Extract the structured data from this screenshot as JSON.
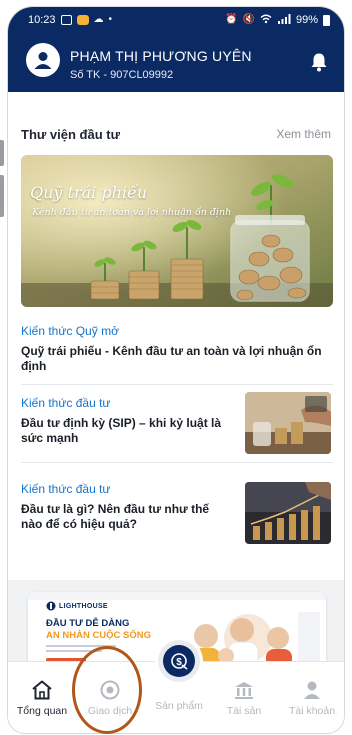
{
  "status_bar": {
    "time": "10:23",
    "battery": "99%"
  },
  "account": {
    "name": "PHẠM THỊ PHƯƠNG UYÊN",
    "number": "Số TK - 907CL09992"
  },
  "library": {
    "title": "Thư viện đầu tư",
    "see_more": "Xem thêm"
  },
  "banner": {
    "title": "Quỹ trái phiếu",
    "subtitle": "Kênh đầu tư an toàn và lợi nhuận ổn định"
  },
  "articles": [
    {
      "category": "Kiến thức Quỹ mở",
      "title": "Quỹ trái phiếu - Kênh đầu tư an toàn và lợi nhuận ổn định"
    },
    {
      "category": "Kiến thức đầu tư",
      "title": "Đầu tư định kỳ (SIP) – khi kỷ luật là sức mạnh"
    },
    {
      "category": "Kiến thức đầu tư",
      "title": "Đầu tư là gì? Nên đầu tư như thế nào để có hiệu quả?"
    }
  ],
  "promo": {
    "logo": "LIGHTHOUSE",
    "headline_1": "ĐẦU TƯ DỄ DÀNG",
    "headline_2": "AN NHÀN CUỘC SỐNG"
  },
  "tabs": [
    {
      "label": "Tổng quan",
      "icon": "home-icon",
      "active": true
    },
    {
      "label": "Giao dịch",
      "icon": "transaction-icon",
      "active": false
    },
    {
      "label": "Sản phẩm",
      "icon": "products-icon",
      "active": false
    },
    {
      "label": "Tài sản",
      "icon": "assets-icon",
      "active": false
    },
    {
      "label": "Tài khoản",
      "icon": "account-icon",
      "active": false
    }
  ],
  "colors": {
    "header": "#0b2a63",
    "link": "#1673c9",
    "annotation": "#b0561a"
  }
}
